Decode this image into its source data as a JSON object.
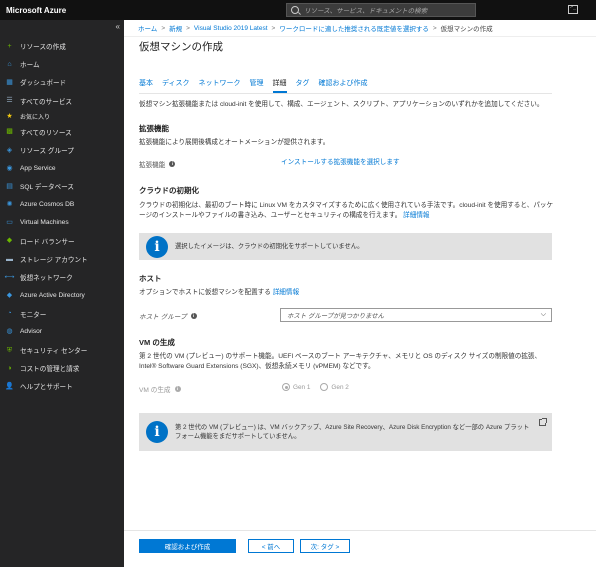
{
  "topbar": {
    "brand": "Microsoft Azure",
    "search_placeholder": "リソース、サービス、ドキュメントの検索"
  },
  "sidebar": {
    "collapse_glyph": "«",
    "items": [
      {
        "label": "リソースの作成",
        "icon": "plus-icon",
        "glyph": "+",
        "color": "#6bb700"
      },
      {
        "label": "ホーム",
        "icon": "home-icon",
        "glyph": "⌂",
        "color": "#3a96dd"
      },
      {
        "label": "ダッシュボード",
        "icon": "dashboard-icon",
        "glyph": "▦",
        "color": "#3a96dd"
      },
      {
        "label": "すべてのサービス",
        "icon": "list-icon",
        "glyph": "☰",
        "color": "#9ab3ca"
      },
      {
        "label": "お気に入り",
        "icon": "star-icon",
        "glyph": "★",
        "color": "#f2c811",
        "fav": true
      },
      {
        "label": "すべてのリソース",
        "icon": "grid-icon",
        "glyph": "▩",
        "color": "#6bb700"
      },
      {
        "label": "リソース グループ",
        "icon": "resource-group-icon",
        "glyph": "◈",
        "color": "#3a96dd"
      },
      {
        "label": "App Service",
        "icon": "app-service-icon",
        "glyph": "◉",
        "color": "#3a96dd"
      },
      {
        "label": "SQL データベース",
        "icon": "sql-database-icon",
        "glyph": "▤",
        "color": "#3a96dd"
      },
      {
        "label": "Azure Cosmos DB",
        "icon": "cosmos-db-icon",
        "glyph": "✺",
        "color": "#3a96dd"
      },
      {
        "label": "Virtual Machines",
        "icon": "virtual-machine-icon",
        "glyph": "▭",
        "color": "#3a96dd"
      },
      {
        "label": "ロード バランサー",
        "icon": "load-balancer-icon",
        "glyph": "◆",
        "color": "#6bb700"
      },
      {
        "label": "ストレージ アカウント",
        "icon": "storage-icon",
        "glyph": "▬",
        "color": "#9ab3ca"
      },
      {
        "label": "仮想ネットワーク",
        "icon": "virtual-network-icon",
        "glyph": "⟷",
        "color": "#3a96dd"
      },
      {
        "label": "Azure Active Directory",
        "icon": "active-directory-icon",
        "glyph": "◆",
        "color": "#3a96dd"
      },
      {
        "label": "モニター",
        "icon": "monitor-icon",
        "glyph": "◔",
        "color": "#3a96dd"
      },
      {
        "label": "Advisor",
        "icon": "advisor-icon",
        "glyph": "◍",
        "color": "#3a96dd"
      },
      {
        "label": "セキュリティ センター",
        "icon": "shield-icon",
        "glyph": "⛨",
        "color": "#6bb700"
      },
      {
        "label": "コストの管理と請求",
        "icon": "cost-icon",
        "glyph": "◑",
        "color": "#6bb700"
      },
      {
        "label": "ヘルプとサポート",
        "icon": "help-icon",
        "glyph": "👤",
        "color": "#3a96dd"
      }
    ]
  },
  "breadcrumb": {
    "items": [
      "ホーム",
      "新規",
      "Visual Studio 2019 Latest",
      "ワークロードに適した推奨される既定値を選択する"
    ],
    "current": "仮想マシンの作成"
  },
  "page": {
    "title": "仮想マシンの作成",
    "tabs": [
      "基本",
      "ディスク",
      "ネットワーク",
      "管理",
      "詳細",
      "タグ",
      "確認および作成"
    ],
    "active_tab": 4,
    "intro": "仮想マシン拡張機能または cloud-init を使用して、構成、エージェント、スクリプト、アプリケーションのいずれかを追加してください。"
  },
  "extensions": {
    "heading": "拡張機能",
    "description": "拡張機能により展開後構成とオートメーションが提供されます。",
    "label": "拡張機能",
    "link": "インストールする拡張機能を選択します"
  },
  "cloud_init": {
    "heading": "クラウドの初期化",
    "description": "クラウドの初期化は、最初のブート時に Linux VM をカスタマイズするために広く使用されている手法です。cloud-init を使用すると、パッケージのインストールやファイルの書き込み、ユーザーとセキュリティの構成を行えます。",
    "link": "詳細情報",
    "notice": "選択したイメージは、クラウドの初期化をサポートしていません。"
  },
  "host": {
    "heading": "ホスト",
    "description": "オプションでホストに仮想マシンを配置する",
    "link": "詳細情報",
    "group_label": "ホスト グループ",
    "group_placeholder": "ホスト グループが見つかりません"
  },
  "vm_generation": {
    "heading": "VM の生成",
    "description": "第 2 世代の VM (プレビュー) のサポート機能。UEFI ベースのブート アーキテクチャ、メモリと OS のディスク サイズの制限値の拡張、Intel® Software Guard Extensions (SGX)、仮想永続メモリ (vPMEM) などです。",
    "label": "VM の生成",
    "options": [
      "Gen 1",
      "Gen 2"
    ],
    "selected": "Gen 1",
    "notice": "第 2 世代の VM (プレビュー) は、VM バックアップ、Azure Site Recovery、Azure Disk Encryption など一部の Azure プラットフォーム機能をまだサポートしていません。"
  },
  "footer": {
    "review_button": "確認および作成",
    "prev_button": "< 前へ",
    "next_button": "次: タグ >"
  }
}
